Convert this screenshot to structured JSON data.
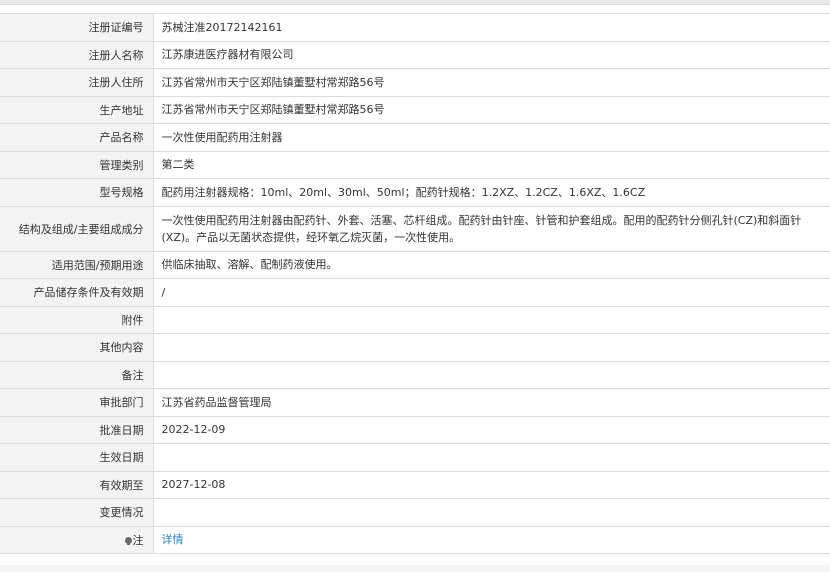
{
  "rows": [
    {
      "label": "注册证编号",
      "value": "苏械注准20172142161"
    },
    {
      "label": "注册人名称",
      "value": "江苏康进医疗器材有限公司"
    },
    {
      "label": "注册人住所",
      "value": "江苏省常州市天宁区郑陆镇董墅村常郑路56号"
    },
    {
      "label": "生产地址",
      "value": "江苏省常州市天宁区郑陆镇董墅村常郑路56号"
    },
    {
      "label": "产品名称",
      "value": "一次性使用配药用注射器"
    },
    {
      "label": "管理类别",
      "value": "第二类"
    },
    {
      "label": "型号规格",
      "value": "配药用注射器规格：10ml、20ml、30ml、50ml；配药针规格：1.2XZ、1.2CZ、1.6XZ、1.6CZ"
    },
    {
      "label": "结构及组成/主要组成成分",
      "value": "一次性使用配药用注射器由配药针、外套、活塞、芯杆组成。配药针由针座、针管和护套组成。配用的配药针分侧孔针(CZ)和斜面针(XZ)。产品以无菌状态提供，经环氧乙烷灭菌，一次性使用。"
    },
    {
      "label": "适用范围/预期用途",
      "value": "供临床抽取、溶解、配制药液使用。"
    },
    {
      "label": "产品储存条件及有效期",
      "value": "/"
    },
    {
      "label": "附件",
      "value": ""
    },
    {
      "label": "其他内容",
      "value": ""
    },
    {
      "label": "备注",
      "value": ""
    },
    {
      "label": "审批部门",
      "value": "江苏省药品监督管理局"
    },
    {
      "label": "批准日期",
      "value": "2022-12-09"
    },
    {
      "label": "生效日期",
      "value": ""
    },
    {
      "label": "有效期至",
      "value": "2027-12-08"
    },
    {
      "label": "变更情况",
      "value": ""
    }
  ],
  "note": {
    "label": "注",
    "icon": "lightbulb-icon",
    "link_text": "详情"
  }
}
